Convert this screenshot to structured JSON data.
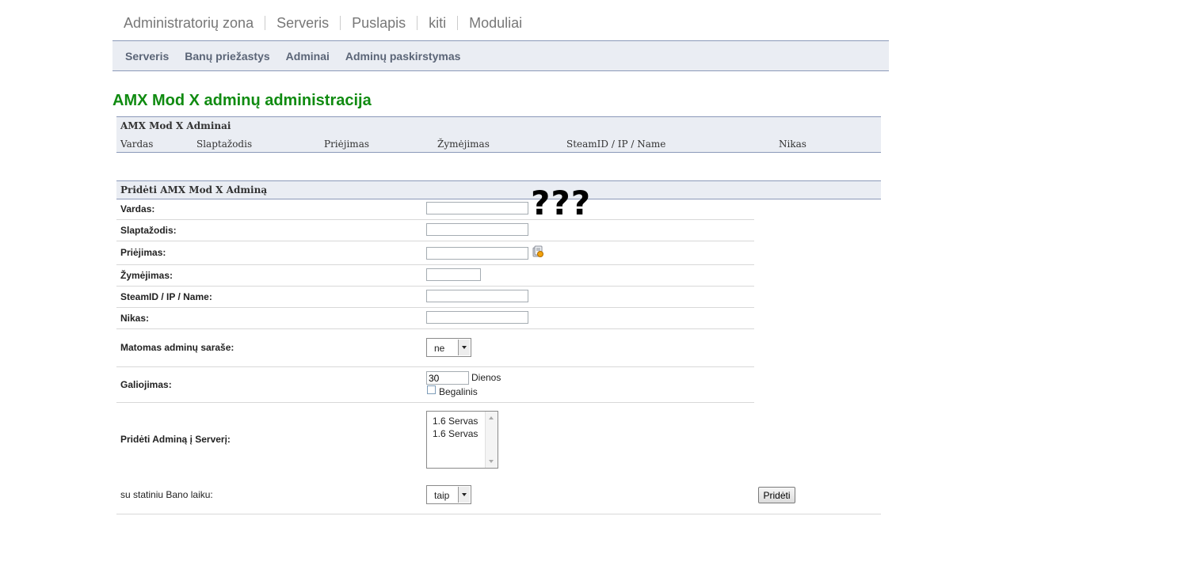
{
  "top_nav": [
    "Administratorių zona",
    "Serveris",
    "Puslapis",
    "kiti",
    "Moduliai"
  ],
  "sub_nav": [
    "Serveris",
    "Banų priežastys",
    "Adminai",
    "Adminų paskirstymas"
  ],
  "page_title": "AMX Mod X adminų administracija",
  "admin_list": {
    "caption": "AMX Mod X Adminai",
    "columns": [
      "Vardas",
      "Slaptažodis",
      "Priėjimas",
      "Žymėjimas",
      "SteamID / IP / Name",
      "Nikas"
    ]
  },
  "add_form": {
    "caption": "Pridėti AMX Mod X Adminą",
    "annotation": "???",
    "fields": {
      "vardas": {
        "label": "Vardas:",
        "value": ""
      },
      "slaptazodis": {
        "label": "Slaptažodis:",
        "value": ""
      },
      "priejimas": {
        "label": "Priėjimas:",
        "value": ""
      },
      "zymejimas": {
        "label": "Žymėjimas:",
        "value": ""
      },
      "steamid": {
        "label": "SteamID / IP / Name:",
        "value": ""
      },
      "nikas": {
        "label": "Nikas:",
        "value": ""
      }
    },
    "visible": {
      "label": "Matomas adminų saraše:",
      "selected": "ne"
    },
    "expiry": {
      "label": "Galiojimas:",
      "value": "30",
      "unit": "Dienos",
      "unlimited_label": "Begalinis",
      "unlimited_checked": false
    },
    "servers": {
      "label": "Pridėti Adminą į Serverį:",
      "options": [
        "1.6 Servas",
        "1.6 Servas"
      ]
    },
    "static_ban": {
      "label": "su statiniu Bano laiku:",
      "selected": "taip"
    },
    "submit_label": "Pridėti"
  }
}
